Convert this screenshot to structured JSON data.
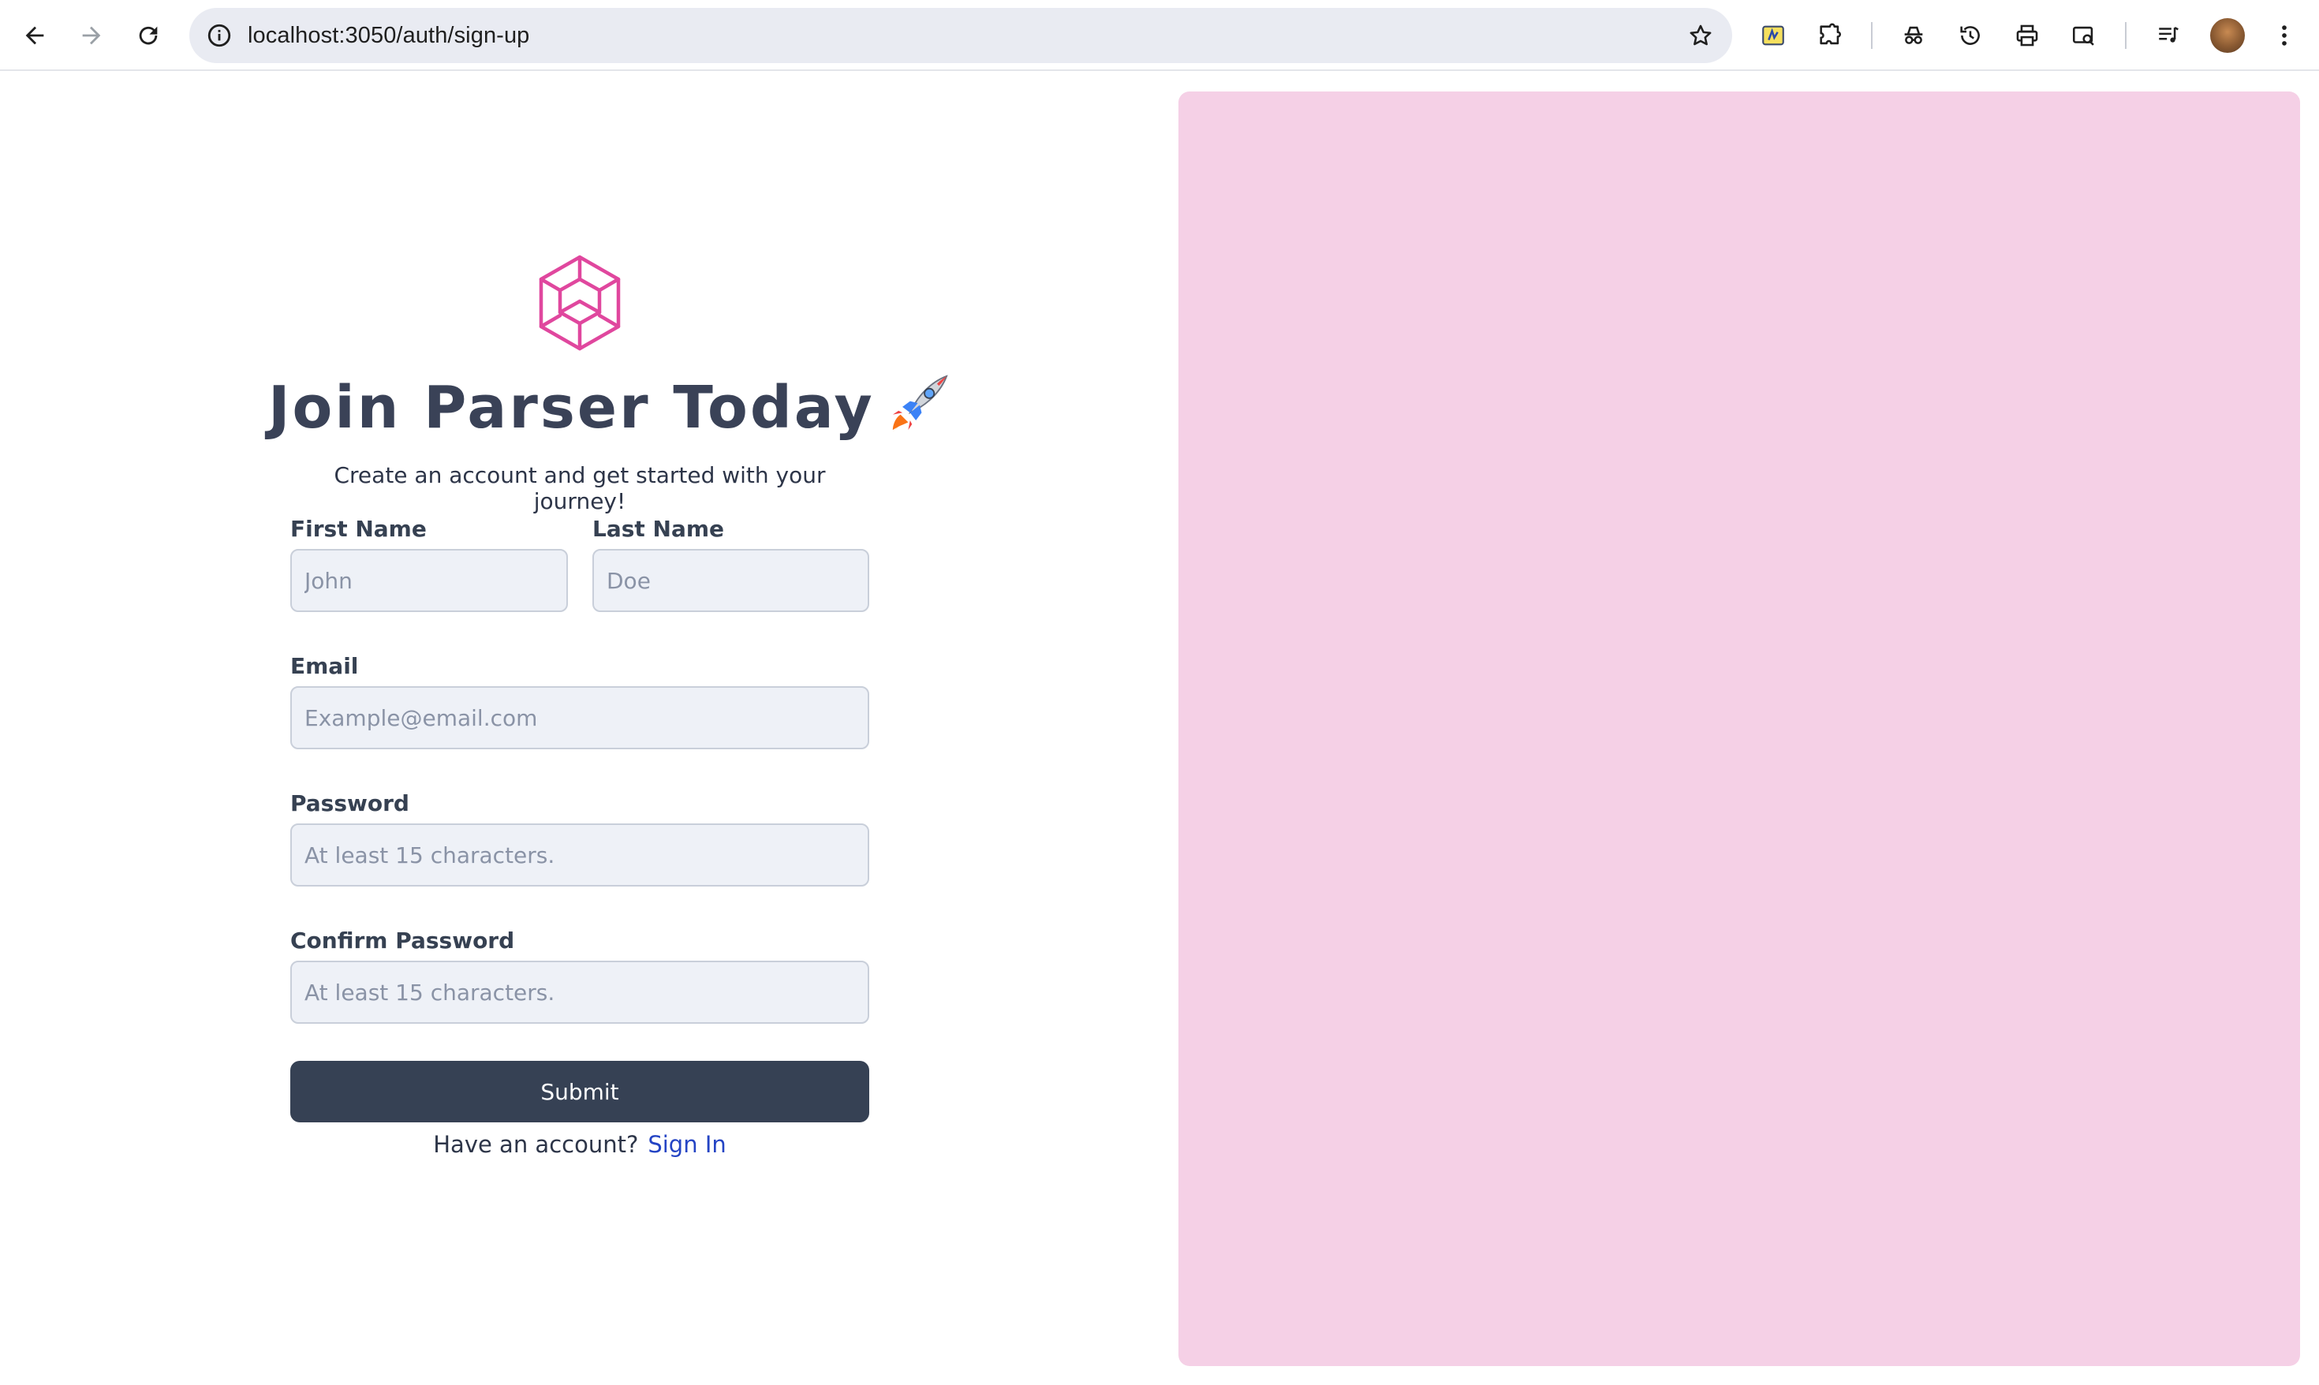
{
  "browser": {
    "url": "localhost:3050/auth/sign-up"
  },
  "brand": {
    "accent_color": "#e0479e",
    "panel_color": "#f5d0e6",
    "button_color": "#364154"
  },
  "signup": {
    "title": "Join Parser Today",
    "subtitle": "Create an account and get started with your journey!",
    "first_name": {
      "label": "First Name",
      "placeholder": "John",
      "value": ""
    },
    "last_name": {
      "label": "Last Name",
      "placeholder": "Doe",
      "value": ""
    },
    "email": {
      "label": "Email",
      "placeholder": "Example@email.com",
      "value": ""
    },
    "password": {
      "label": "Password",
      "placeholder": "At least 15 characters.",
      "value": ""
    },
    "confirm_password": {
      "label": "Confirm Password",
      "placeholder": "At least 15 characters.",
      "value": ""
    },
    "submit_label": "Submit",
    "have_account_text": "Have an account?",
    "sign_in_label": "Sign In"
  }
}
